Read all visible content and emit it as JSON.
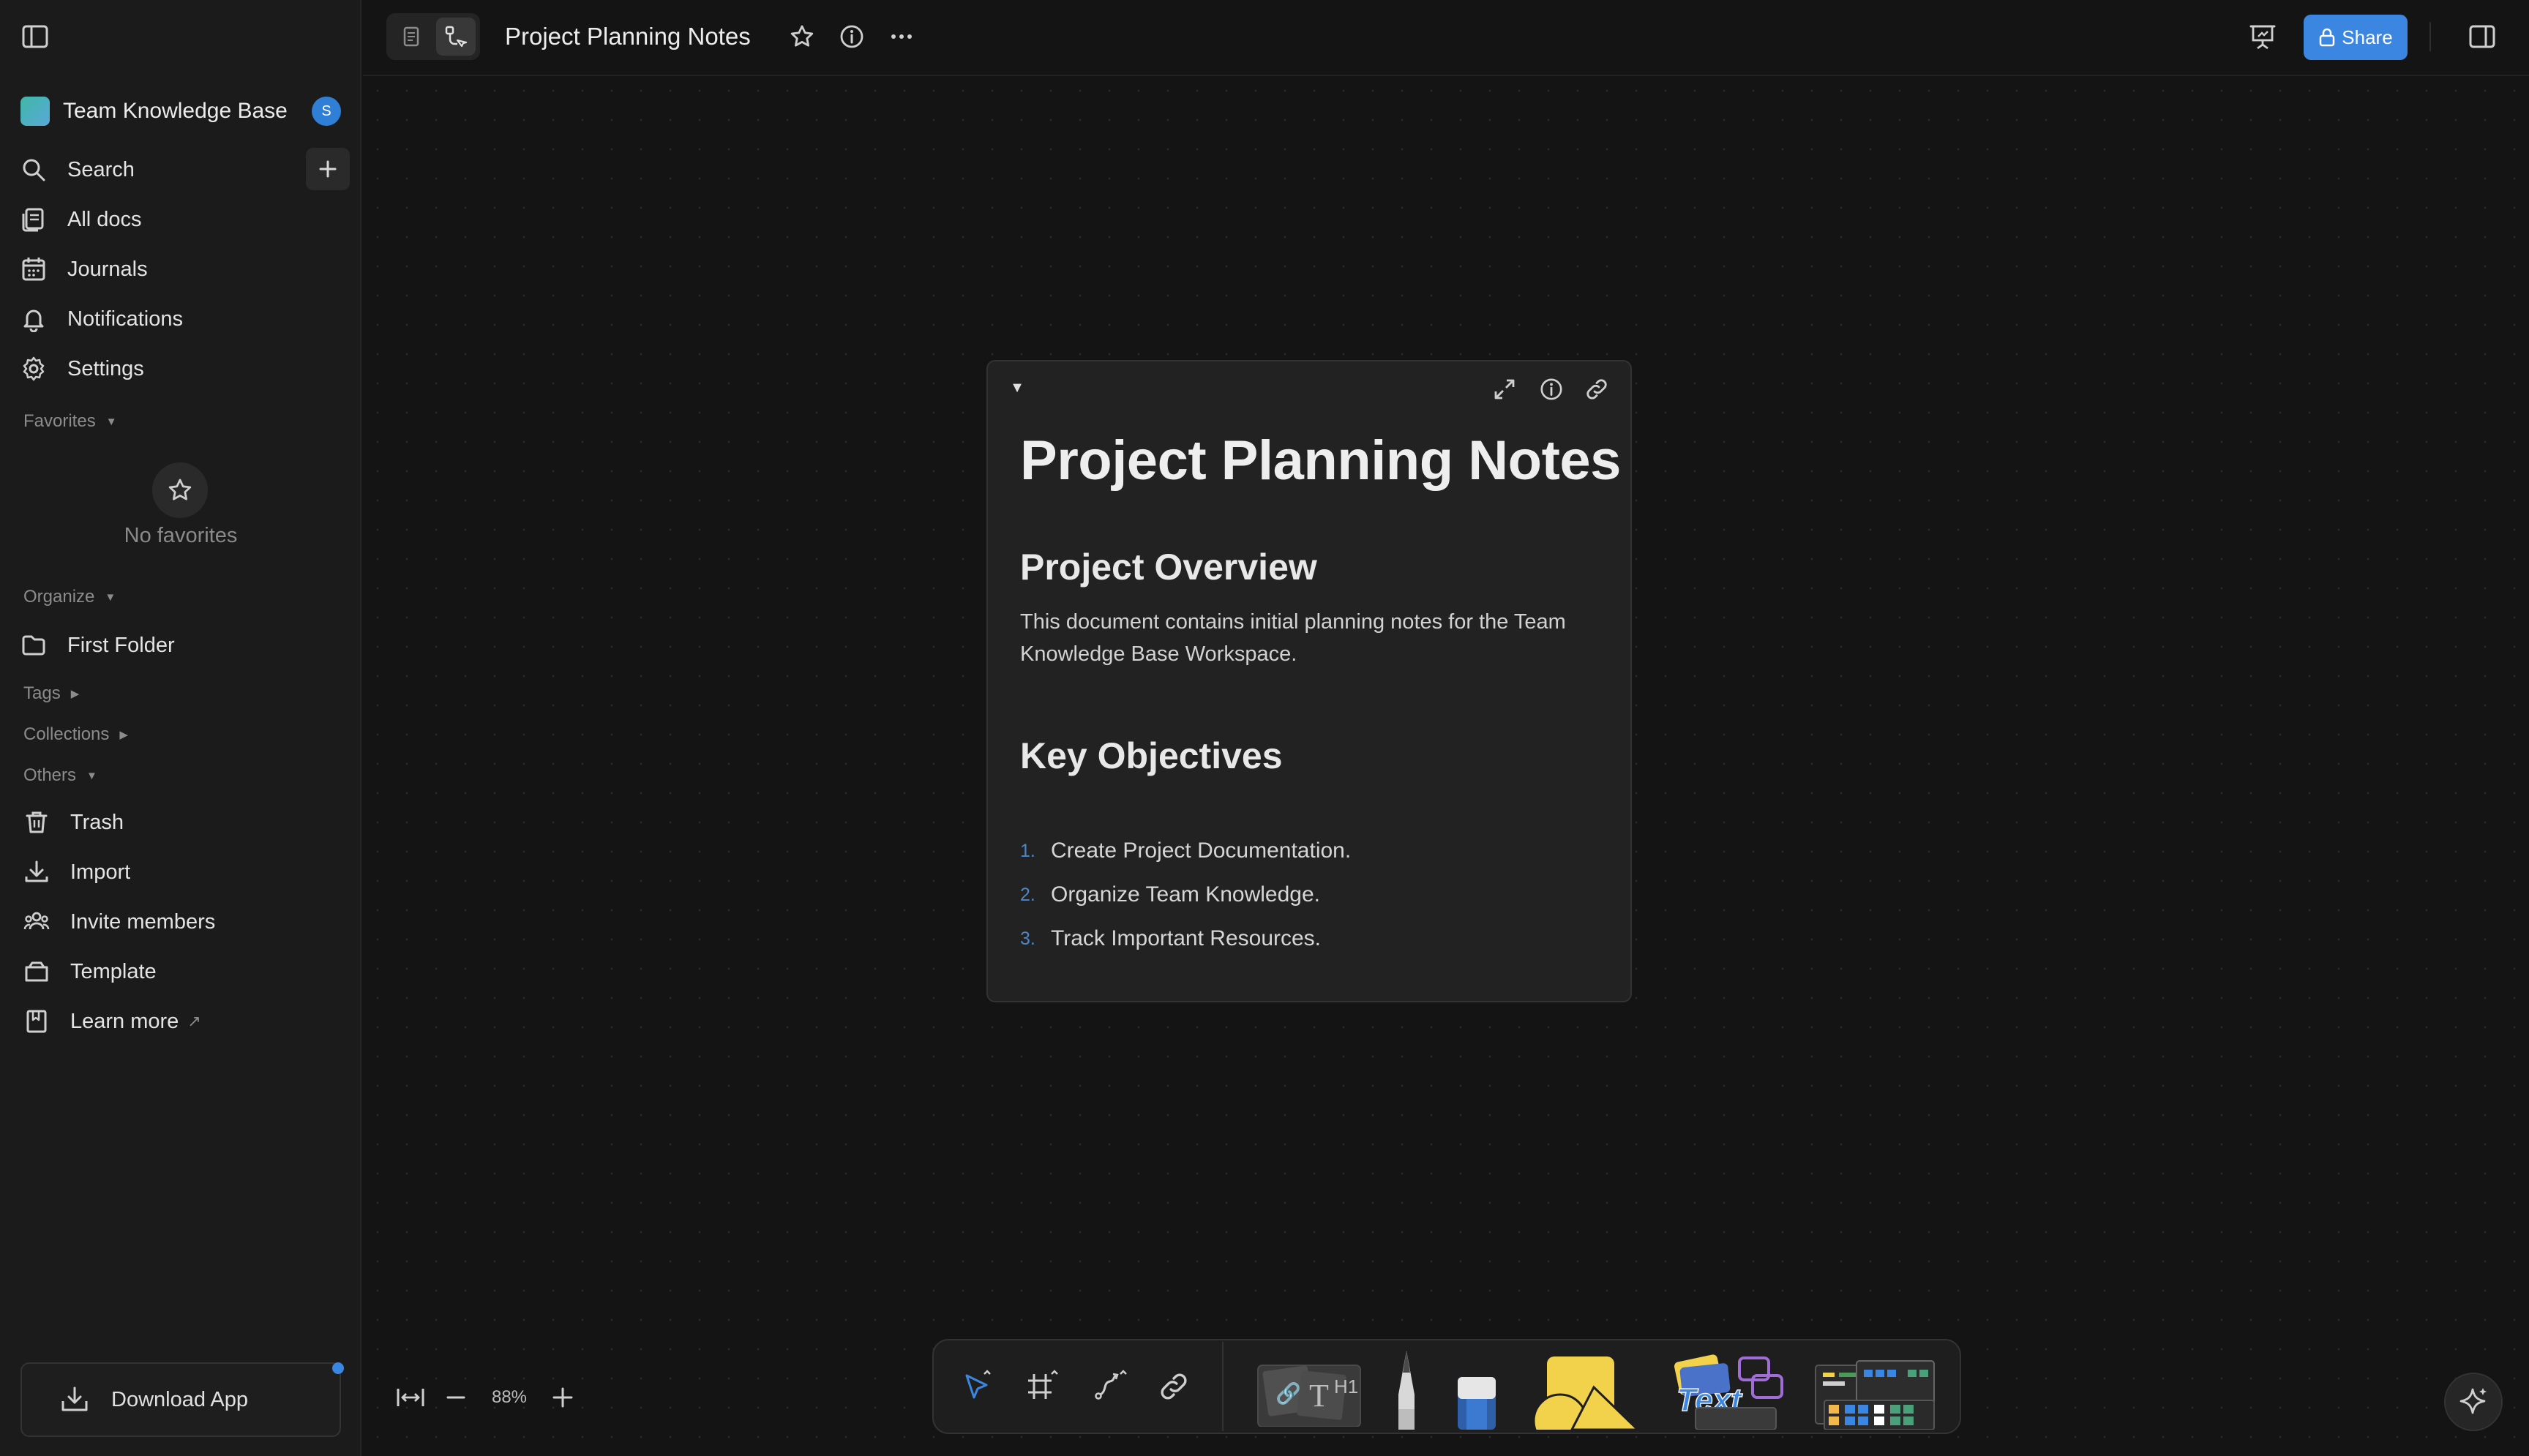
{
  "sidebar": {
    "workspace_name": "Team Knowledge Base",
    "avatar_letter": "S",
    "nav": {
      "search": "Search",
      "all_docs": "All docs",
      "journals": "Journals",
      "notifications": "Notifications",
      "settings": "Settings"
    },
    "favorites_label": "Favorites",
    "no_favorites": "No favorites",
    "organize_label": "Organize",
    "first_folder": "First Folder",
    "tags_label": "Tags",
    "collections_label": "Collections",
    "others_label": "Others",
    "others": {
      "trash": "Trash",
      "import": "Import",
      "invite": "Invite members",
      "template": "Template",
      "learn_more": "Learn more"
    },
    "download_app": "Download App"
  },
  "topbar": {
    "doc_title": "Project Planning Notes",
    "share_label": "Share"
  },
  "document": {
    "title": "Project Planning Notes",
    "overview_heading": "Project Overview",
    "overview_text": "This document contains initial planning notes for the Team Knowledge Base Workspace.",
    "objectives_heading": "Key Objectives",
    "objectives": [
      {
        "num": "1.",
        "text": "Create Project Documentation."
      },
      {
        "num": "2.",
        "text": "Organize Team Knowledge."
      },
      {
        "num": "3.",
        "text": "Track Important Resources."
      }
    ]
  },
  "zoom": {
    "level": "88%"
  },
  "colors": {
    "accent": "#3b86e0",
    "list_number": "#4f86c6",
    "sticky_yellow": "#f2d14b"
  }
}
